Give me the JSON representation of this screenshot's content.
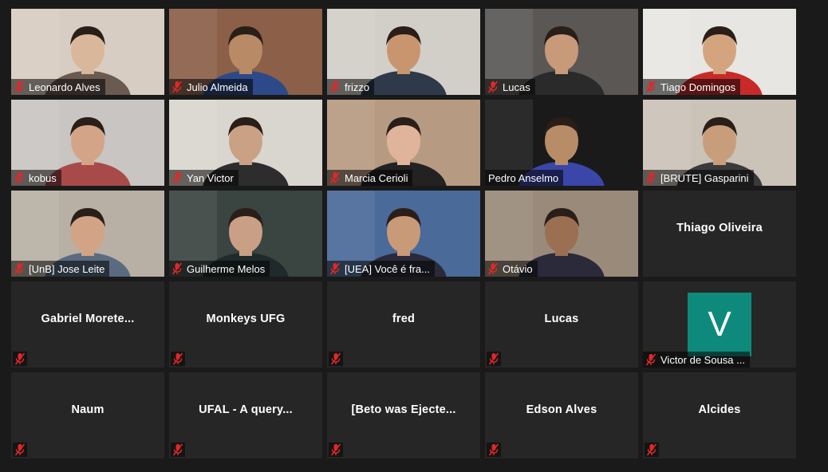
{
  "participants": [
    {
      "name": "Leonardo Alves",
      "video": true,
      "bg": "#d8cdc2",
      "skin": "#d9b79a",
      "shirt": "#6a5a50"
    },
    {
      "name": "Julio Almeida",
      "video": true,
      "bg": "#8b5f48",
      "skin": "#b88a66",
      "shirt": "#2c4a8a"
    },
    {
      "name": "frizzo",
      "video": true,
      "bg": "#d2cfc8",
      "skin": "#c9956f",
      "shirt": "#2e3a4a"
    },
    {
      "name": "Lucas",
      "video": true,
      "bg": "#5a5755",
      "skin": "#c89a7a",
      "shirt": "#2a2a2a"
    },
    {
      "name": "Tiago Domingos",
      "video": true,
      "bg": "#e8e6e2",
      "skin": "#d4a47f",
      "shirt": "#c82a2a"
    },
    {
      "name": "kobus",
      "video": true,
      "bg": "#c8c5c2",
      "skin": "#d3a488",
      "shirt": "#a84a4a"
    },
    {
      "name": "Yan Victor",
      "video": true,
      "bg": "#d9d6d0",
      "skin": "#caa184",
      "shirt": "#2d2d2d"
    },
    {
      "name": "Marcia Cerioli",
      "video": true,
      "bg": "#b79a82",
      "skin": "#e0b49a",
      "shirt": "#222222"
    },
    {
      "name": "Pedro Anselmo",
      "video": true,
      "bg": "#1a1a1a",
      "skin": "#b98c68",
      "shirt": "#3a46a8"
    },
    {
      "name": "[BRUTE] Gasparini",
      "video": true,
      "bg": "#cbc2b8",
      "skin": "#c79d7c",
      "shirt": "#3a3a3a"
    },
    {
      "name": "[UnB] Jose Leite",
      "video": true,
      "bg": "#b8b0a4",
      "skin": "#d2a485",
      "shirt": "#5a6a80"
    },
    {
      "name": "Guilherme Melos",
      "video": true,
      "bg": "#3a4441",
      "skin": "#c9a085",
      "shirt": "#202a2a"
    },
    {
      "name": "[UEA] Você é fra...",
      "video": true,
      "bg": "#4a6a9a",
      "skin": "#c99a78",
      "shirt": "#2a2a3a"
    },
    {
      "name": "Otávio",
      "video": true,
      "bg": "#9a8a7a",
      "skin": "#9a6f52",
      "shirt": "#2a2a3a"
    },
    {
      "name": "Thiago Oliveira",
      "video": false
    },
    {
      "name": "Gabriel  Morete...",
      "video": false,
      "muted": true
    },
    {
      "name": "Monkeys UFG",
      "video": false,
      "muted": true
    },
    {
      "name": "fred",
      "video": false,
      "muted": true
    },
    {
      "name": "Lucas",
      "video": false,
      "muted": true
    },
    {
      "name": "Victor de Sousa ...",
      "video": false,
      "avatar": "V",
      "avatar_color": "#0e8a7c"
    },
    {
      "name": "Naum",
      "video": false,
      "muted": true
    },
    {
      "name": "UFAL - A query...",
      "video": false,
      "muted": true
    },
    {
      "name": "[Beto was Ejecte...",
      "video": false,
      "muted": true
    },
    {
      "name": "Edson Alves",
      "video": false,
      "muted": true
    },
    {
      "name": "Alcides",
      "video": false,
      "muted": true
    }
  ]
}
